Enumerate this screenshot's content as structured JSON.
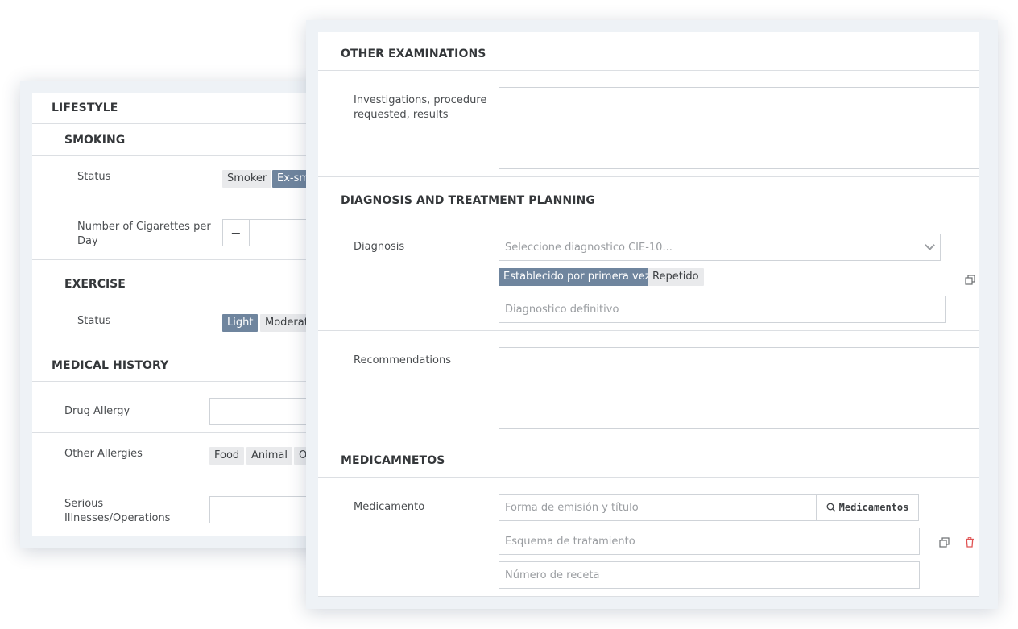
{
  "lifestyle": {
    "title": "LIFESTYLE",
    "smoking": {
      "title": "SMOKING",
      "status_label": "Status",
      "status_options": [
        "Smoker",
        "Ex-sm"
      ],
      "selected": "Ex-sm",
      "cigarettes_label": "Number of Cigarettes per Day",
      "cigarettes_value": ""
    },
    "exercise": {
      "title": "EXERCISE",
      "status_label": "Status",
      "status_options": [
        "Light",
        "Moderat"
      ],
      "selected": "Light"
    }
  },
  "medical_history": {
    "title": "MEDICAL HISTORY",
    "drug_allergy_label": "Drug Allergy",
    "drug_allergy_value": "",
    "other_allergies_label": "Other Allergies",
    "other_allergies_options": [
      "Food",
      "Animal",
      "O"
    ],
    "serious_label": "Serious Illnesses/Operations",
    "serious_value": ""
  },
  "other_examinations": {
    "title": "OTHER EXAMINATIONS",
    "investigations_label": "Investigations, procedure requested, results",
    "investigations_value": ""
  },
  "diagnosis": {
    "title": "DIAGNOSIS AND TREATMENT PLANNING",
    "diagnosis_label": "Diagnosis",
    "select_placeholder": "Seleccione diagnostico CIE-10...",
    "type_options": [
      "Establecido por primera vez",
      "Repetido"
    ],
    "selected_type": "Establecido por primera vez",
    "definitive_placeholder": "Diagnostico definitivo",
    "recommendations_label": "Recommendations",
    "recommendations_value": ""
  },
  "medicamentos": {
    "title": "MEDICAMNETOS",
    "medicamento_label": "Medicamento",
    "form_placeholder": "Forma de emisión y título",
    "search_button_label": "Medicamentos",
    "scheme_placeholder": "Esquema de tratamiento",
    "prescription_placeholder": "Número de receta"
  },
  "colors": {
    "active_chip": "#6f859e",
    "chip": "#e9eaec",
    "delete_icon": "#e05353",
    "panel_frame": "#eef2f6"
  },
  "icons": {
    "copy": "copy-icon",
    "delete": "trash-icon",
    "search": "search-icon",
    "dropdown": "chevron-down-icon"
  }
}
